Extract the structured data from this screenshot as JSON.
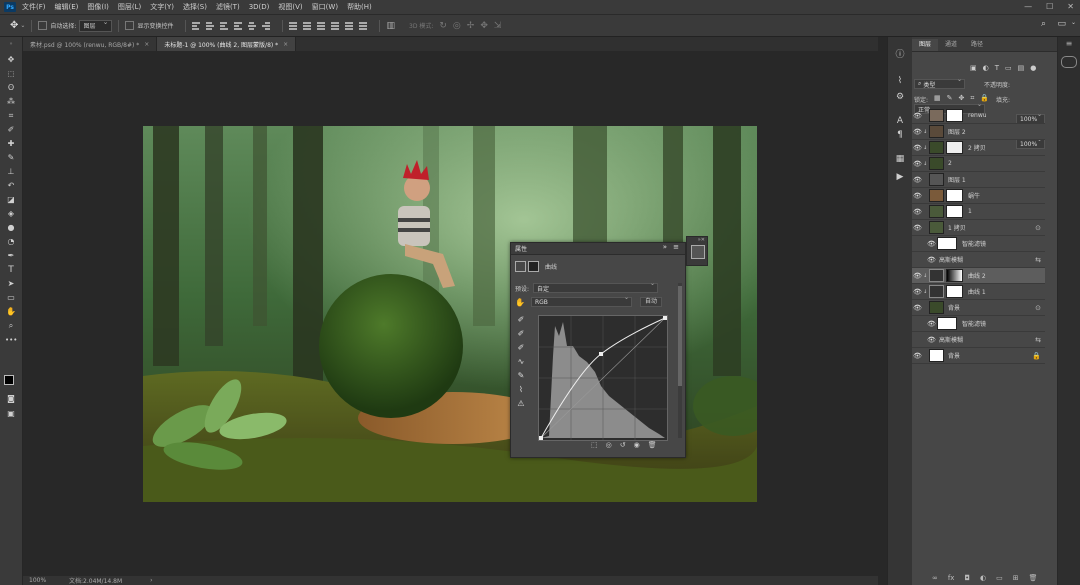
{
  "menubar": {
    "logo": "Ps",
    "items": [
      "文件(F)",
      "编辑(E)",
      "图像(I)",
      "图层(L)",
      "文字(Y)",
      "选择(S)",
      "滤镜(T)",
      "3D(D)",
      "视图(V)",
      "窗口(W)",
      "帮助(H)"
    ]
  },
  "options": {
    "auto_select_label": "自动选择:",
    "auto_select_value": "图层",
    "show_transform": "显示变换控件",
    "mode_3d": "3D 模式:"
  },
  "tabs": [
    {
      "label": "素材.psd @ 100% (renwu, RGB/8#) *",
      "close": "×"
    },
    {
      "label": "未标题-1 @ 100% (曲线 2, 图层蒙版/8) *",
      "close": "×"
    }
  ],
  "status": {
    "zoom": "100%",
    "doc": "文档:2.04M/14.8M",
    "arrow": "›"
  },
  "properties": {
    "title": "属性",
    "panel_name": "曲线",
    "preset_label": "预设:",
    "preset_value": "自定",
    "channel_value": "RGB",
    "auto_button": "自动"
  },
  "layers_panel": {
    "tabs": [
      "图层",
      "通道",
      "路径"
    ],
    "kind_value": "类型",
    "blend_mode": "正常",
    "opacity_label": "不透明度:",
    "opacity_value": "100%",
    "lock_label": "锁定:",
    "fill_label": "填充:",
    "fill_value": "100%",
    "layers": [
      {
        "name": "renwu",
        "thumb": "#7a6a5c"
      },
      {
        "name": "图层 2",
        "thumb": "#5a4a3a"
      },
      {
        "name": "2 拷贝",
        "thumb": "#3a4a2a"
      },
      {
        "name": "2",
        "thumb": "#3a4a2a"
      },
      {
        "name": "图层 1",
        "thumb": "#555"
      },
      {
        "name": "蜗牛",
        "thumb": "#7a5a3a"
      },
      {
        "name": "1",
        "thumb": "#4a5a3a"
      },
      {
        "name": "1 拷贝",
        "thumb": "#4a5a3a"
      },
      {
        "name": "智能滤镜",
        "thumb": "#fff"
      },
      {
        "name": "高斯模糊",
        "thumb": ""
      },
      {
        "name": "曲线 2",
        "thumb": ""
      },
      {
        "name": "曲线 1",
        "thumb": ""
      },
      {
        "name": "背景",
        "thumb": "#3a4a2a"
      },
      {
        "name": "智能滤镜",
        "thumb": "#fff"
      },
      {
        "name": "高斯模糊",
        "thumb": ""
      },
      {
        "name": "背景",
        "thumb": "#fff"
      }
    ]
  },
  "colors": {
    "accent": "#31a8ff",
    "panel": "#474747",
    "bg": "#282828"
  }
}
